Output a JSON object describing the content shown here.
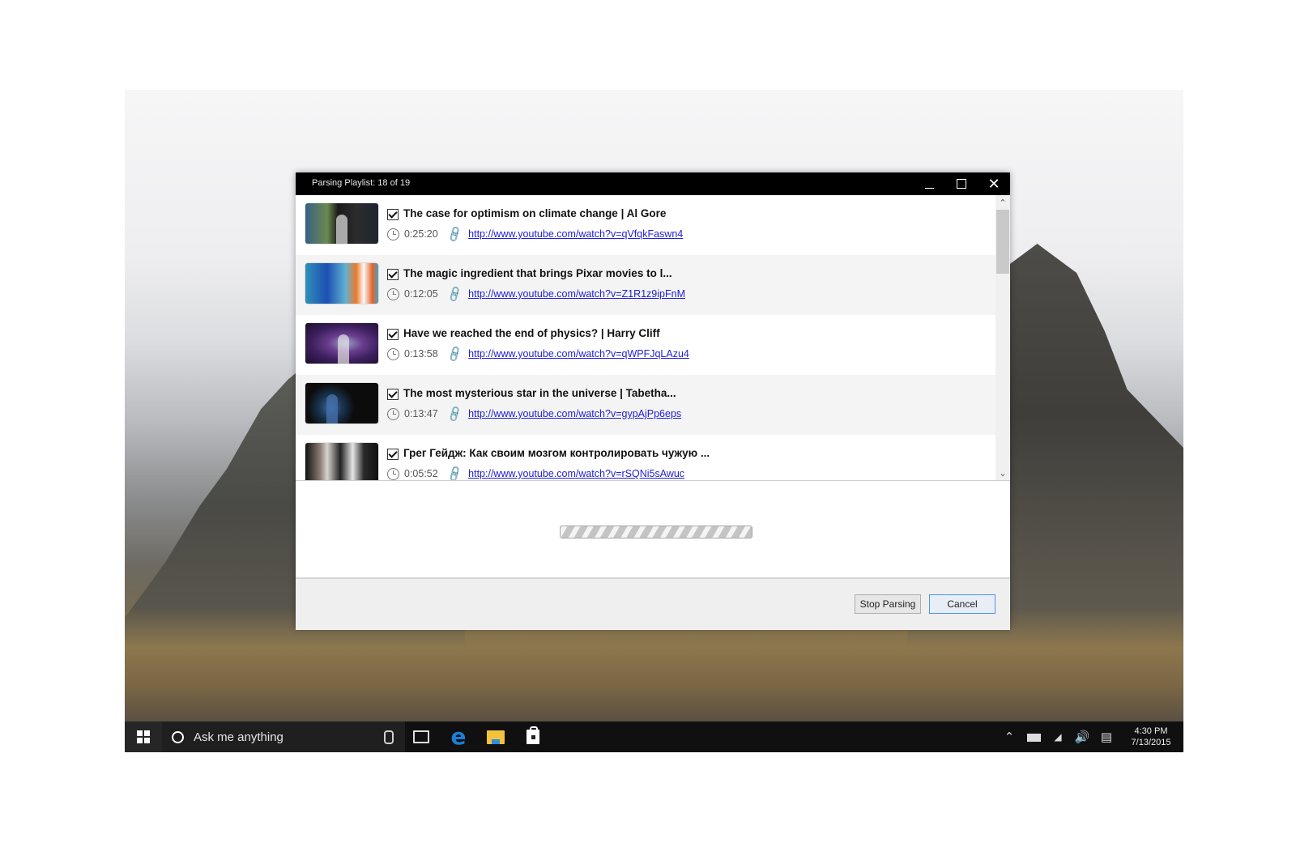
{
  "window": {
    "title": "Parsing Playlist: 18 of 19",
    "controls": {
      "minimize": "minimize",
      "maximize": "maximize",
      "close": "close"
    }
  },
  "videos": [
    {
      "title": "The case for optimism on climate change | Al Gore",
      "duration": "0:25:20",
      "url": "http://www.youtube.com/watch?v=qVfqkFaswn4",
      "checked": true
    },
    {
      "title": "The magic ingredient that brings Pixar movies to l...",
      "duration": "0:12:05",
      "url": "http://www.youtube.com/watch?v=Z1R1z9ipFnM",
      "checked": true
    },
    {
      "title": "Have we reached the end of physics? | Harry Cliff",
      "duration": "0:13:58",
      "url": "http://www.youtube.com/watch?v=qWPFJqLAzu4",
      "checked": true
    },
    {
      "title": "The most mysterious star in the universe | Tabetha...",
      "duration": "0:13:47",
      "url": "http://www.youtube.com/watch?v=gypAjPp6eps",
      "checked": true
    },
    {
      "title": "Грег Гейдж: Как своим мозгом контролировать чужую ...",
      "duration": "0:05:52",
      "url": "http://www.youtube.com/watch?v=rSQNi5sAwuc",
      "checked": true
    }
  ],
  "progress": {
    "state": "indeterminate"
  },
  "buttons": {
    "stop": "Stop Parsing",
    "cancel": "Cancel"
  },
  "taskbar": {
    "search_placeholder": "Ask me anything",
    "time": "4:30 PM",
    "date": "7/13/2015",
    "pinned": [
      "task-view",
      "edge",
      "file-explorer",
      "store"
    ]
  },
  "colors": {
    "link": "#2020d8",
    "titlebar": "#000000",
    "cancel_border": "#4d95e6"
  }
}
